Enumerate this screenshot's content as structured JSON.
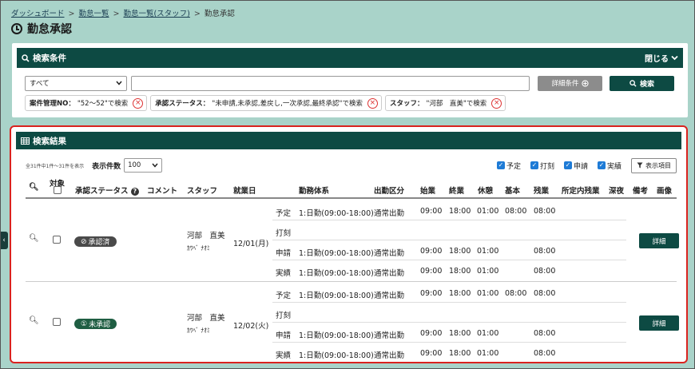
{
  "breadcrumb": {
    "items": [
      "ダッシュボード",
      "勤怠一覧",
      "勤怠一覧(スタッフ)"
    ],
    "current": "勤怠承認",
    "separator": ">"
  },
  "page": {
    "title": "勤怠承認"
  },
  "search": {
    "header": "検索条件",
    "close_label": "閉じる",
    "select_value": "すべて",
    "text_value": "",
    "detail_button": "詳細条件",
    "search_button": "検索",
    "chips": [
      {
        "label": "案件管理NO：",
        "value": "\"52～52\"で検索"
      },
      {
        "label": "承認ステータス：",
        "value": "\"未申請,未承認,差戻し,一次承認,最終承認\"で検索"
      },
      {
        "label": "スタッフ：",
        "value": "\"河部　直美\"で検索"
      }
    ]
  },
  "results": {
    "header": "検索結果",
    "count_text": "全31件中1件～31件を表示",
    "perpage_label": "表示件数",
    "perpage_value": "100",
    "filters": [
      {
        "label": "予定",
        "checked": true
      },
      {
        "label": "打刻",
        "checked": true
      },
      {
        "label": "申請",
        "checked": true
      },
      {
        "label": "実績",
        "checked": true
      }
    ],
    "columns_button": "表示項目",
    "columns": {
      "target": "対象",
      "status": "承認ステータス",
      "comment": "コメント",
      "staff": "スタッフ",
      "date": "就業日",
      "shift": "勤務体系",
      "attendance": "出勤区分",
      "start": "始業",
      "end": "終業",
      "break": "休憩",
      "basic": "基本",
      "overtime": "残業",
      "scheduled_ot": "所定内残業",
      "night": "深夜",
      "notes": "備考",
      "image": "画像"
    },
    "rows": [
      {
        "status": "承認済",
        "staff_name": "河部　直美",
        "staff_kana": "ｶﾜﾍﾞ ﾅｵﾐ",
        "date": "12/01(月)",
        "detail_button": "詳細",
        "subrows": [
          {
            "type": "予定",
            "shift": "1:日勤(09:00-18:00)",
            "attendance": "通常出勤",
            "start": "09:00",
            "end": "18:00",
            "break": "01:00",
            "basic": "08:00",
            "overtime": "08:00"
          },
          {
            "type": "打刻",
            "shift": "",
            "attendance": "",
            "start": "",
            "end": "",
            "break": "",
            "basic": "",
            "overtime": ""
          },
          {
            "type": "申請",
            "shift": "1:日勤(09:00-18:00)",
            "attendance": "通常出勤",
            "start": "09:00",
            "end": "18:00",
            "break": "01:00",
            "basic": "",
            "overtime": "08:00"
          },
          {
            "type": "実績",
            "shift": "1:日勤(09:00-18:00)",
            "attendance": "通常出勤",
            "start": "09:00",
            "end": "18:00",
            "break": "01:00",
            "basic": "",
            "overtime": "08:00"
          }
        ]
      },
      {
        "status": "未承認",
        "staff_name": "河部　直美",
        "staff_kana": "ｶﾜﾍﾞ ﾅｵﾐ",
        "date": "12/02(火)",
        "detail_button": "詳細",
        "subrows": [
          {
            "type": "予定",
            "shift": "1:日勤(09:00-18:00)",
            "attendance": "通常出勤",
            "start": "09:00",
            "end": "18:00",
            "break": "01:00",
            "basic": "08:00",
            "overtime": "08:00"
          },
          {
            "type": "打刻",
            "shift": "",
            "attendance": "",
            "start": "",
            "end": "",
            "break": "",
            "basic": "",
            "overtime": ""
          },
          {
            "type": "申請",
            "shift": "1:日勤(09:00-18:00)",
            "attendance": "通常出勤",
            "start": "09:00",
            "end": "18:00",
            "break": "01:00",
            "basic": "",
            "overtime": "08:00"
          },
          {
            "type": "実績",
            "shift": "1:日勤(09:00-18:00)",
            "attendance": "通常出勤",
            "start": "09:00",
            "end": "18:00",
            "break": "01:00",
            "basic": "",
            "overtime": "08:00"
          }
        ]
      }
    ]
  },
  "colors": {
    "header_bg": "#0d4a43",
    "page_bg": "#a9d3c9",
    "highlight_border": "#d9231f"
  }
}
